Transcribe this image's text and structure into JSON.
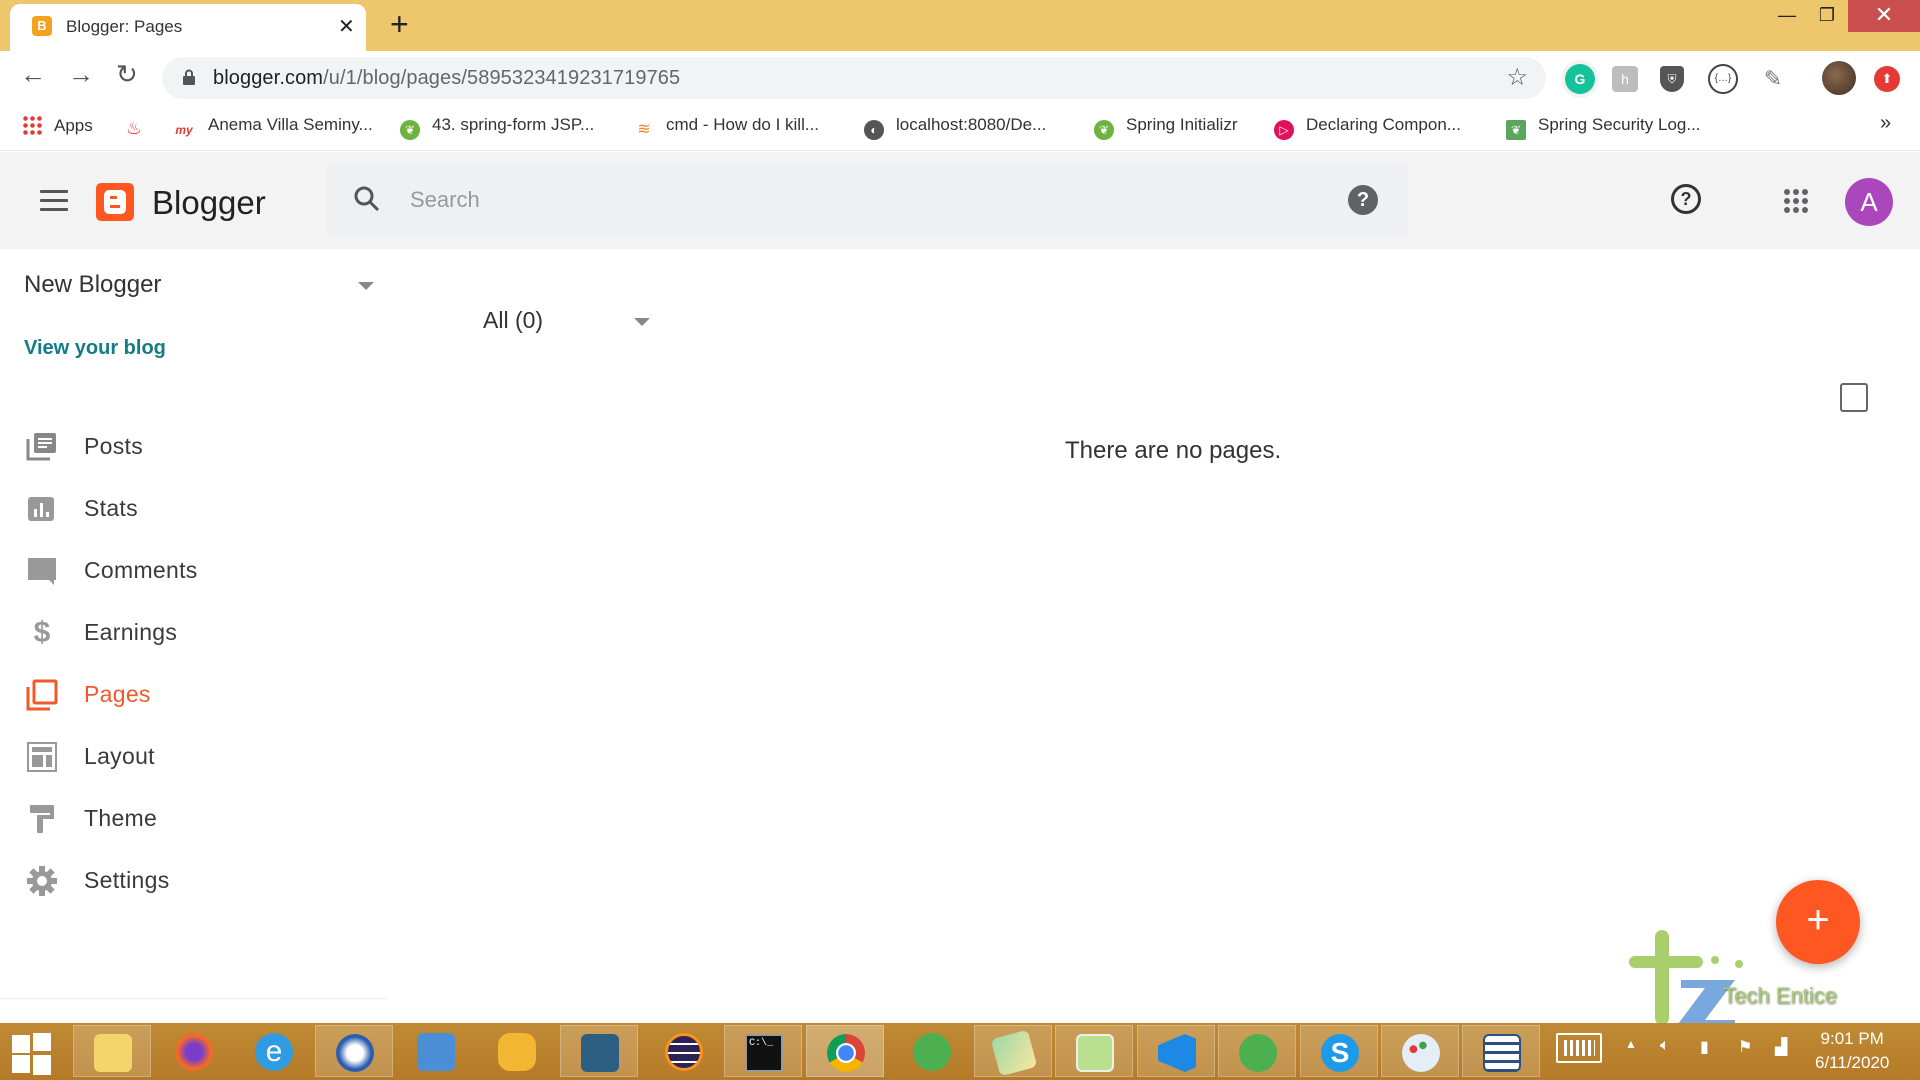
{
  "browser": {
    "tab_title": "Blogger: Pages",
    "tab_favicon": "blogger-favicon",
    "new_tab_label": "+",
    "window_controls": {
      "minimize": "—",
      "maximize": "❐",
      "close": "✕"
    },
    "nav": {
      "back": "←",
      "forward": "→",
      "reload": "↻"
    },
    "url": {
      "host": "blogger.com",
      "path": "/u/1/blog/pages/5895323419231719765"
    },
    "star_icon": "☆",
    "extensions": [
      {
        "name": "grammarly-extension",
        "glyph": "G",
        "color": "#15C39A"
      },
      {
        "name": "honey-extension",
        "glyph": "h",
        "color": "#BDBDBD"
      },
      {
        "name": "adblock-extension",
        "glyph": "⛨",
        "color": "#555555"
      },
      {
        "name": "json-extension",
        "glyph": "{…}",
        "color": "#ffffff"
      },
      {
        "name": "colorpicker-extension",
        "glyph": "✎",
        "color": "#ffffff"
      },
      {
        "name": "profile-avatar",
        "glyph": "",
        "color": "#5A4636"
      },
      {
        "name": "update-extension",
        "glyph": "⬆",
        "color": "#E53935"
      }
    ],
    "bookmarks": [
      {
        "label": "Apps",
        "icon": "apps-grid",
        "color": "#E53935"
      },
      {
        "label": "",
        "icon": "flame",
        "color": "#E53935"
      },
      {
        "label": "Anema Villa Seminy...",
        "icon": "my-logo",
        "color": "#E53935"
      },
      {
        "label": "43. spring-form JSP...",
        "icon": "spring-leaf",
        "color": "#6DB33F"
      },
      {
        "label": "cmd - How do I kill...",
        "icon": "stackoverflow",
        "color": "#F48024"
      },
      {
        "label": "localhost:8080/De...",
        "icon": "globe",
        "color": "#555555"
      },
      {
        "label": "Spring Initializr",
        "icon": "spring-leaf",
        "color": "#6DB33F"
      },
      {
        "label": "Declaring Compon...",
        "icon": "pluralsight",
        "color": "#E0105A"
      },
      {
        "label": "Spring Security Log...",
        "icon": "spring-leaf-square",
        "color": "#5CA55C"
      }
    ],
    "bookmarks_overflow": "»"
  },
  "header": {
    "app_name": "Blogger",
    "search_placeholder": "Search",
    "search_help": "?",
    "help": "?",
    "avatar_letter": "A",
    "avatar_color": "#AB47BC"
  },
  "sidebar": {
    "blog_name": "New Blogger",
    "view_blog": "View your blog",
    "items": [
      {
        "label": "Posts",
        "icon": "posts-icon",
        "active": false
      },
      {
        "label": "Stats",
        "icon": "stats-icon",
        "active": false
      },
      {
        "label": "Comments",
        "icon": "comments-icon",
        "active": false
      },
      {
        "label": "Earnings",
        "icon": "earnings-icon",
        "active": false
      },
      {
        "label": "Pages",
        "icon": "pages-icon",
        "active": true
      },
      {
        "label": "Layout",
        "icon": "layout-icon",
        "active": false
      },
      {
        "label": "Theme",
        "icon": "theme-icon",
        "active": false
      },
      {
        "label": "Settings",
        "icon": "settings-icon",
        "active": false
      }
    ],
    "accent_color": "#F0592A"
  },
  "main": {
    "filter_label": "All (0)",
    "empty_message": "There are no pages.",
    "fab_label": "+"
  },
  "watermark": {
    "text": "Tech Entice"
  },
  "taskbar": {
    "apps": [
      "file-explorer",
      "firefox",
      "internet-explorer",
      "thunderbird",
      "remote-desktop",
      "db-tool",
      "mysql-workbench",
      "eclipse",
      "command-prompt",
      "chrome",
      "spring-tool-suite",
      "sticky-notes",
      "notepad-plus-plus",
      "vscode",
      "spring-tool-suite-2",
      "skype",
      "paint",
      "file-manager"
    ],
    "time": "9:01 PM",
    "date": "6/11/2020"
  }
}
